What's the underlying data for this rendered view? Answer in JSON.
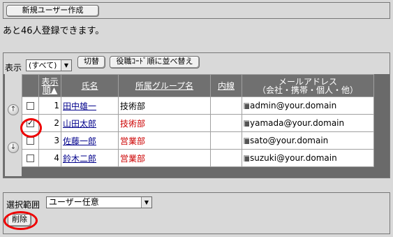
{
  "header": {
    "new_user_label": "新規ユーザー作成",
    "remaining_text": "あと46人登録できます。"
  },
  "toolbar": {
    "display_label": "表示",
    "filter_value": "(すべて)",
    "switch_label": "切替",
    "sort_label": "役職ｺｰﾄﾞ順に並べ替え"
  },
  "table": {
    "columns": {
      "order_line1": "表示",
      "order_line2": "順▲",
      "name": "氏名",
      "group": "所属グループ名",
      "extension": "内線",
      "email_line1": "メールアドレス",
      "email_line2": "（会社・携帯・個人・他）"
    },
    "rows": [
      {
        "order": "1",
        "name": "田中雄一",
        "group": "技術部",
        "extension": "",
        "email": "admin@your.domain",
        "checked": false
      },
      {
        "order": "2",
        "name": "山田太郎",
        "group": "技術部",
        "extension": "",
        "email": "yamada@your.domain",
        "checked": true
      },
      {
        "order": "3",
        "name": "佐藤一郎",
        "group": "営業部",
        "extension": "",
        "email": "sato@your.domain",
        "checked": false
      },
      {
        "order": "4",
        "name": "鈴木二郎",
        "group": "営業部",
        "extension": "",
        "email": "suzuki@your.domain",
        "checked": false
      }
    ]
  },
  "bottom": {
    "range_label": "選択範囲",
    "range_value": "ユーザー任意",
    "delete_label": "削除"
  }
}
